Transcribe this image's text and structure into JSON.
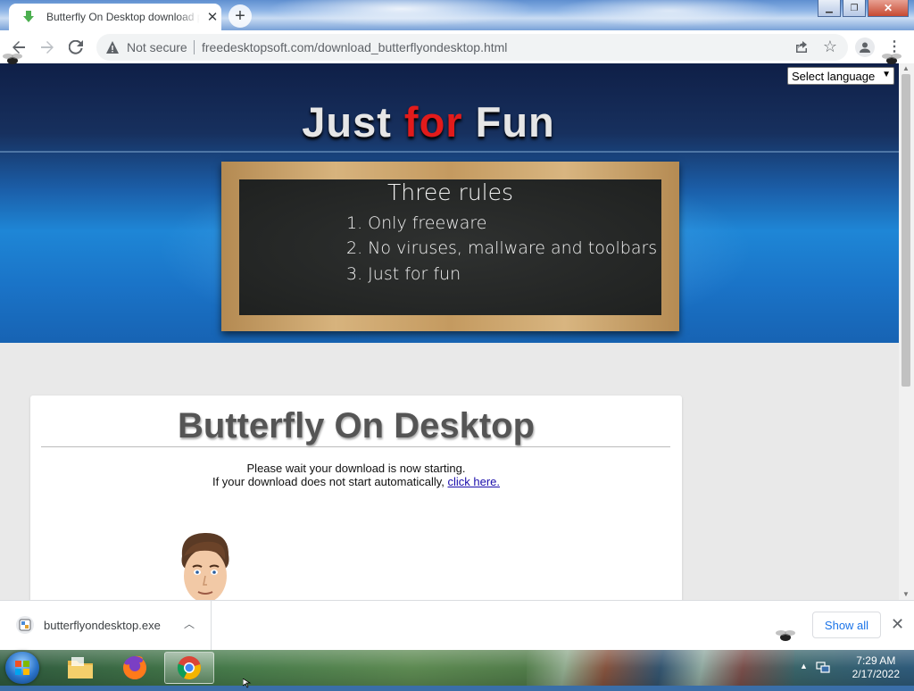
{
  "browser": {
    "tab_title": "Butterfly On Desktop download p",
    "security_label": "Not secure",
    "url": "freedesktopsoft.com/download_butterflyondesktop.html"
  },
  "page": {
    "language_select": "Select language",
    "banner": {
      "headline_word1": "Just",
      "headline_word2": "for",
      "headline_word3": "Fun"
    },
    "chalkboard": {
      "title": "Three rules",
      "rules": [
        "1. Only freeware",
        "2. No viruses, mallware and toolbars",
        "3. Just for fun"
      ]
    },
    "card": {
      "title": "Butterfly On Desktop",
      "line1": "Please wait your download is now starting.",
      "line2": "If your download does not start automatically,",
      "link": "click here."
    }
  },
  "download_shelf": {
    "filename": "butterflyondesktop.exe",
    "show_all": "Show all"
  },
  "taskbar": {
    "time": "7:29 AM",
    "date": "2/17/2022"
  },
  "colors": {
    "headline_accent": "#e21b1b",
    "link": "#1a0dab",
    "show_all": "#1a73e8"
  }
}
